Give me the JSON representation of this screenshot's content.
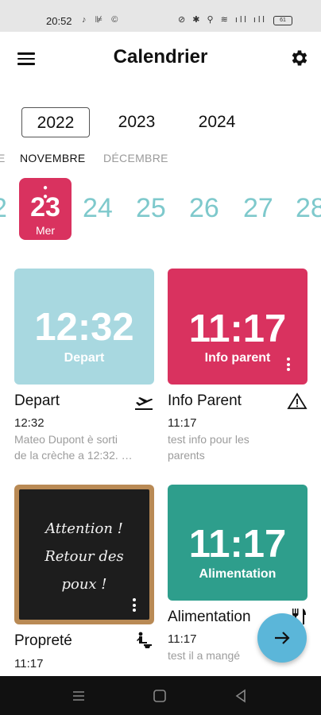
{
  "status_bar": {
    "time": "20:52",
    "left_icons": "♪ ⊯ ©",
    "right_icons": "⊘ ✱ ⚲ ≋ ıll ıll",
    "battery": "61"
  },
  "header": {
    "title": "Calendrier",
    "menu_icon": "hamburger-icon",
    "settings_icon": "gear-icon"
  },
  "years": [
    "2022",
    "2023",
    "2024"
  ],
  "selected_year": "2022",
  "months": {
    "prev_partial": "E",
    "active": "NOVEMBRE",
    "next": "DÉCEMBRE"
  },
  "days": {
    "prev_partial": "2",
    "selected": {
      "number": "23",
      "weekday": "Mer"
    },
    "others": [
      "24",
      "25",
      "26",
      "27",
      "28"
    ]
  },
  "colors": {
    "accent_pink": "#d9325f",
    "day_teal": "#7ec9cc",
    "tile_blue": "#a8d8e0",
    "tile_green": "#2e9e8c",
    "fab_blue": "#5bb6d9"
  },
  "cards": [
    {
      "tile_time": "12:32",
      "tile_label": "Depart",
      "title": "Depart",
      "time": "12:32",
      "desc_line1": "Mateo Dupont è sorti",
      "desc_line2": "de la crèche a 12:32. …",
      "icon": "airplane-departure-icon"
    },
    {
      "tile_time": "11:17",
      "tile_label": "Info parent",
      "title": "Info Parent",
      "time": "11:17",
      "desc_line1": "test info pour les",
      "desc_line2": "parents",
      "icon": "warning-icon"
    },
    {
      "image_line1": "Attention !",
      "image_line2": "Retour des",
      "image_line3": "poux !",
      "title": "Propreté",
      "time": "11:17",
      "icon": "potty-icon"
    },
    {
      "tile_time": "11:17",
      "tile_label": "Alimentation",
      "title": "Alimentation",
      "time": "11:17",
      "desc_line1": "test il a mangé",
      "icon": "fork-knife-icon"
    }
  ],
  "fab": {
    "icon": "arrow-right-icon"
  },
  "nav": {
    "icons": [
      "menu-nav-icon",
      "home-nav-icon",
      "back-nav-icon"
    ]
  }
}
